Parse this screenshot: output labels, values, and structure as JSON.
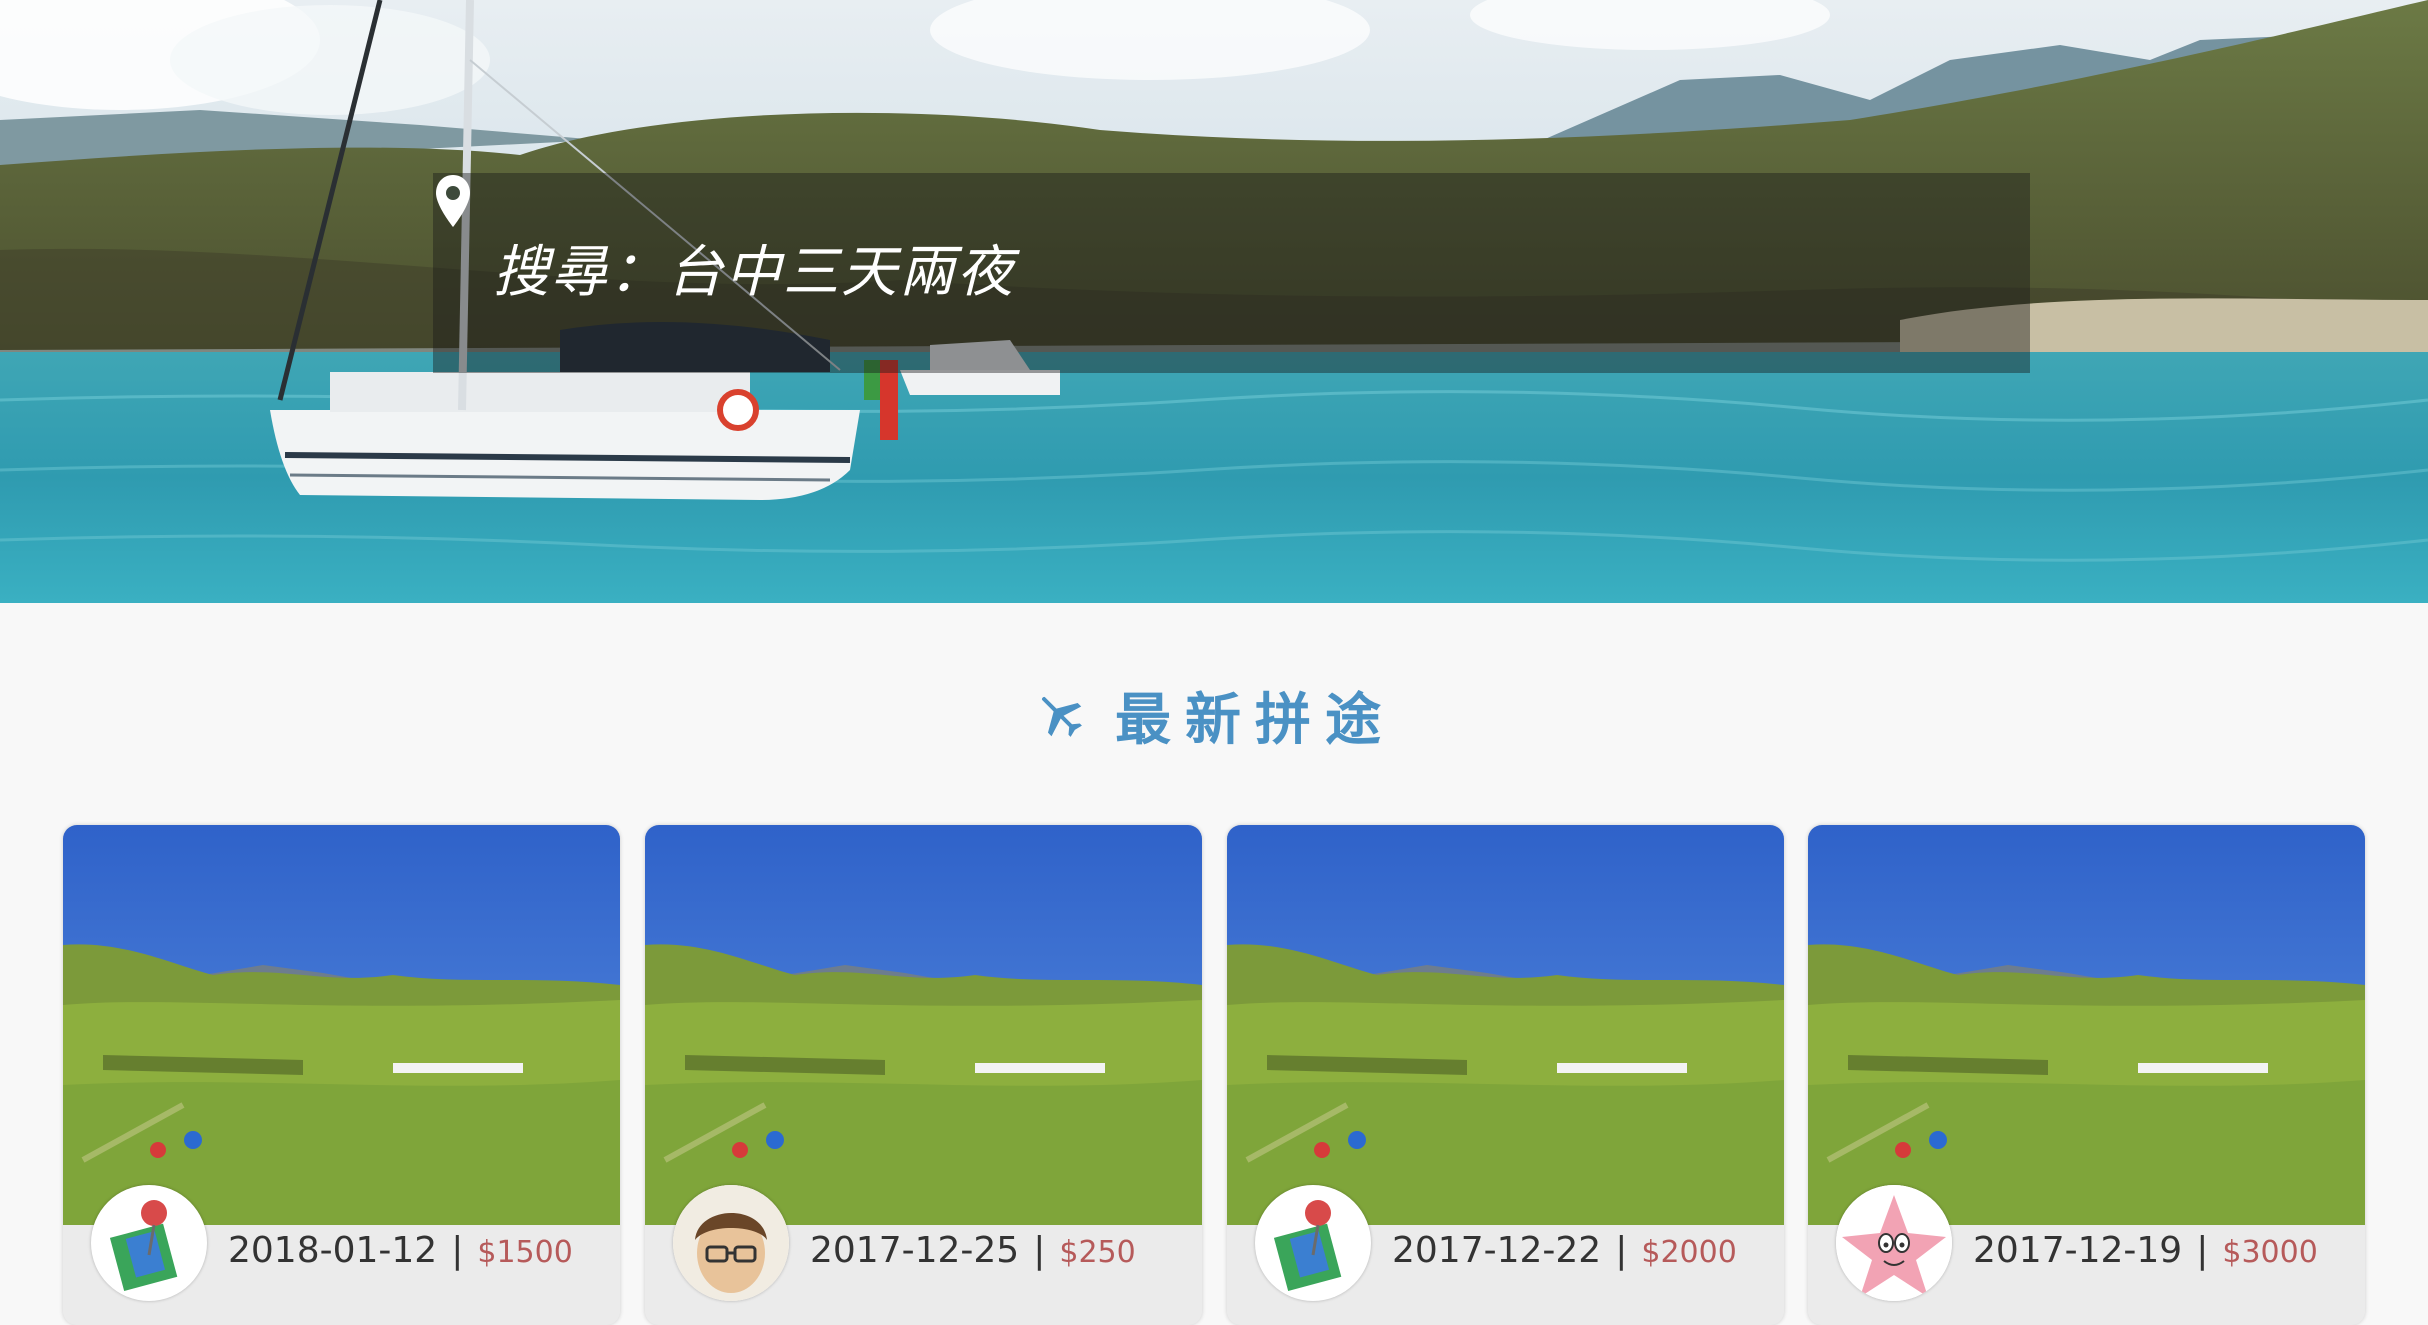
{
  "search": {
    "placeholder": "搜尋：台中三天兩夜"
  },
  "section": {
    "title": "最新拼途",
    "icon": "airplane-icon"
  },
  "cards": [
    {
      "date": "2018-01-12",
      "price": "$1500",
      "avatar": "map-pin-avatar"
    },
    {
      "date": "2017-12-25",
      "price": "$250",
      "avatar": "cartoon-man-avatar"
    },
    {
      "date": "2017-12-22",
      "price": "$2000",
      "avatar": "map-pin-avatar"
    },
    {
      "date": "2017-12-19",
      "price": "$3000",
      "avatar": "starfish-avatar"
    }
  ],
  "colors": {
    "accent": "#4a91c4",
    "price": "#b65a5a"
  }
}
